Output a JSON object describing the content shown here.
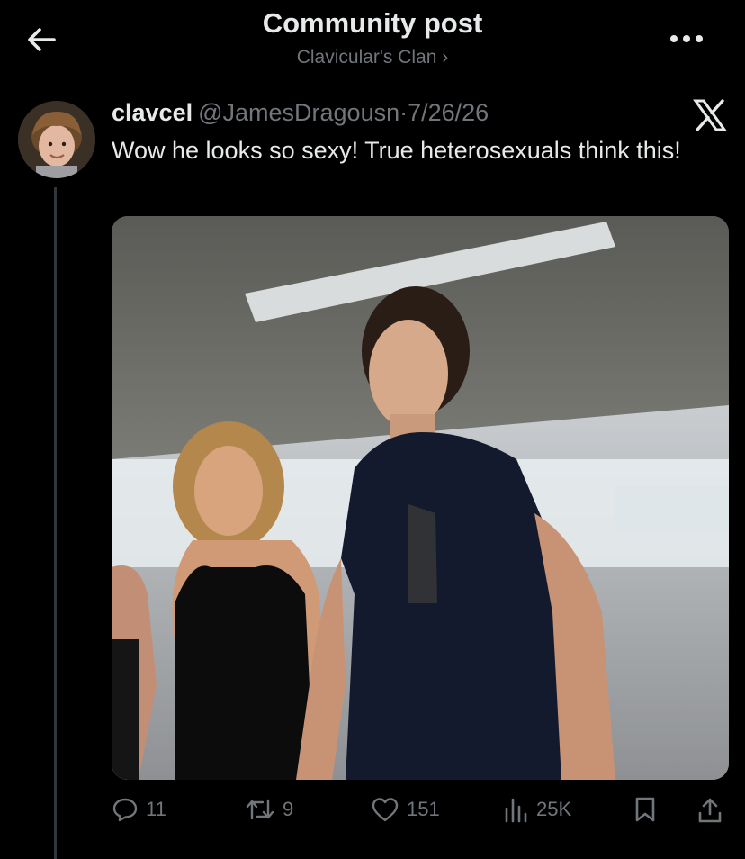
{
  "header": {
    "title": "Community post",
    "subtitle": "Clavicular's Clan ›"
  },
  "post": {
    "display_name": "clavcel",
    "handle": "@JamesDragousn",
    "separator": "·",
    "date": "7/26/26",
    "text": "Wow he looks so sexy! True heterosexuals think this!",
    "media_description": "photo"
  },
  "actions": {
    "replies": "11",
    "reposts": "9",
    "likes": "151",
    "views": "25K"
  },
  "icons": {
    "back": "back-arrow-icon",
    "more": "more-dots-icon",
    "x_logo": "x-logo-icon",
    "reply": "reply-icon",
    "repost": "repost-icon",
    "like": "heart-icon",
    "views": "views-icon",
    "bookmark": "bookmark-icon",
    "share": "share-icon"
  },
  "colors": {
    "background": "#000000",
    "text_primary": "#e7e9ea",
    "text_secondary": "#71767b"
  }
}
